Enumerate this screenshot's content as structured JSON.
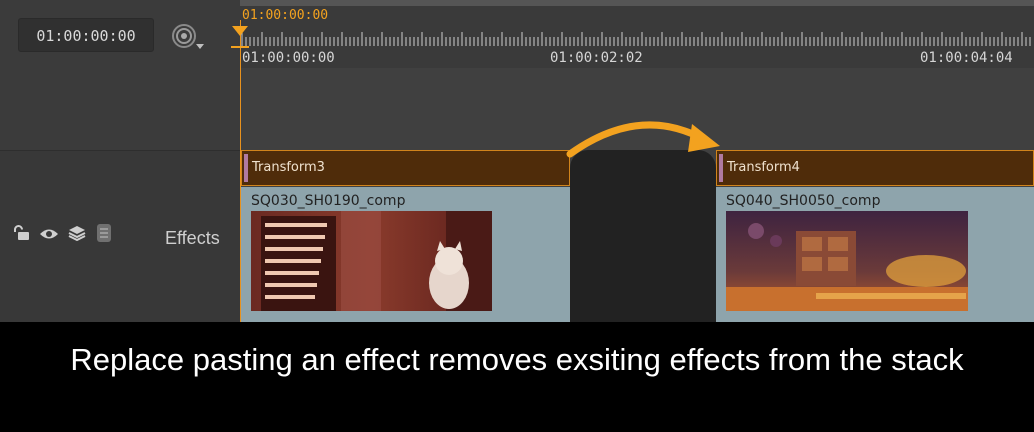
{
  "header": {
    "current_timecode": "01:00:00:00",
    "snap_icon": "snap-target-icon"
  },
  "ruler": {
    "playhead_timecode": "01:00:00:00",
    "labels": [
      "01:00:00:00",
      "01:00:02:02",
      "01:00:04:04"
    ]
  },
  "track": {
    "name": "Effects",
    "icons": [
      "lock-icon",
      "eye-icon",
      "layers-icon",
      "disk-icon"
    ]
  },
  "clips": [
    {
      "effect_name": "Transform3",
      "clip_name": "SQ030_SH0190_comp"
    },
    {
      "effect_name": "Transform4",
      "clip_name": "SQ040_SH0050_comp"
    }
  ],
  "colors": {
    "accent": "#f3a21f",
    "effect_bar": "#4f2c0a",
    "clip_body": "#8ea4ac"
  },
  "caption": {
    "text": "Replace pasting an effect removes exsiting effects from the stack"
  }
}
